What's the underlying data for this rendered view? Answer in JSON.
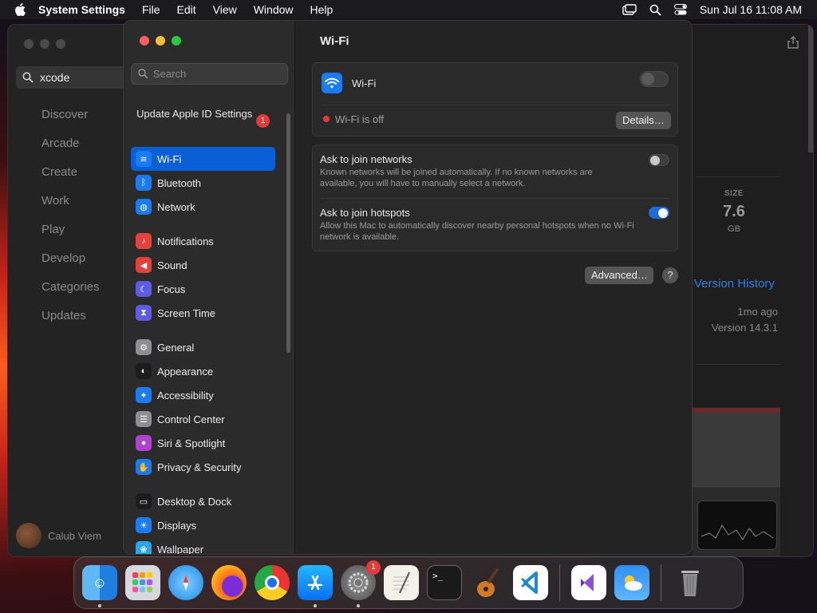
{
  "menubar": {
    "app_name": "System Settings",
    "menus": [
      "File",
      "Edit",
      "View",
      "Window",
      "Help"
    ],
    "clock": "Sun Jul 16  11:08 AM"
  },
  "appstore": {
    "search_value": "xcode",
    "nav": [
      "Discover",
      "Arcade",
      "Create",
      "Work",
      "Play",
      "Develop",
      "Categories",
      "Updates"
    ],
    "user_name": "Calub Viem",
    "size_label": "SIZE",
    "size_value": "7.6",
    "size_unit": "GB",
    "version_history": "Version History",
    "updated_ago": "1mo ago",
    "version": "Version 14.3.1"
  },
  "settings": {
    "search_placeholder": "Search",
    "update_apple_id": "Update Apple ID Settings",
    "update_badge": "1",
    "sidebar": [
      {
        "label": "Wi-Fi",
        "icon": "wifi-icon",
        "color": "#1a7cf5",
        "selected": true
      },
      {
        "label": "Bluetooth",
        "icon": "bluetooth-icon",
        "color": "#1a7cf5"
      },
      {
        "label": "Network",
        "icon": "globe-icon",
        "color": "#1a7cf5"
      },
      {
        "label": "Notifications",
        "icon": "bell-icon",
        "color": "#e8413c"
      },
      {
        "label": "Sound",
        "icon": "speaker-icon",
        "color": "#e8413c"
      },
      {
        "label": "Focus",
        "icon": "moon-icon",
        "color": "#5e5ce6"
      },
      {
        "label": "Screen Time",
        "icon": "hourglass-icon",
        "color": "#5e5ce6"
      },
      {
        "label": "General",
        "icon": "gear-icon",
        "color": "#8e8e93"
      },
      {
        "label": "Appearance",
        "icon": "appearance-icon",
        "color": "#1c1c1e"
      },
      {
        "label": "Accessibility",
        "icon": "accessibility-icon",
        "color": "#1a7cf5"
      },
      {
        "label": "Control Center",
        "icon": "control-center-icon",
        "color": "#8e8e93"
      },
      {
        "label": "Siri & Spotlight",
        "icon": "siri-icon",
        "color": "#b040d0"
      },
      {
        "label": "Privacy & Security",
        "icon": "hand-icon",
        "color": "#1a7cf5"
      },
      {
        "label": "Desktop & Dock",
        "icon": "desktop-icon",
        "color": "#1c1c1e"
      },
      {
        "label": "Displays",
        "icon": "sun-icon",
        "color": "#1a7cf5"
      },
      {
        "label": "Wallpaper",
        "icon": "wallpaper-icon",
        "color": "#2aa7e8"
      }
    ],
    "page_title": "Wi-Fi",
    "wifi_label": "Wi-Fi",
    "wifi_enabled": false,
    "wifi_status": "Wi-Fi is off",
    "details_button": "Details…",
    "ask_networks_title": "Ask to join networks",
    "ask_networks_desc": "Known networks will be joined automatically. If no known networks are available, you will have to manually select a network.",
    "ask_networks_enabled": false,
    "ask_hotspots_title": "Ask to join hotspots",
    "ask_hotspots_desc": "Allow this Mac to automatically discover nearby personal hotspots when no Wi-Fi network is available.",
    "ask_hotspots_enabled": true,
    "advanced_button": "Advanced…",
    "help_button": "?"
  },
  "dock": {
    "apps": [
      "Finder",
      "Launchpad",
      "Safari",
      "Firefox",
      "Chrome",
      "App Store",
      "System Settings",
      "TextEdit",
      "Terminal",
      "GarageBand",
      "Visual Studio Code",
      "Visual Studio",
      "Weather",
      "Trash"
    ],
    "settings_badge": "1"
  },
  "colors": {
    "accent": "#0a5fd6",
    "toggle_on": "#1e6be0",
    "status_off": "#e5393a"
  }
}
